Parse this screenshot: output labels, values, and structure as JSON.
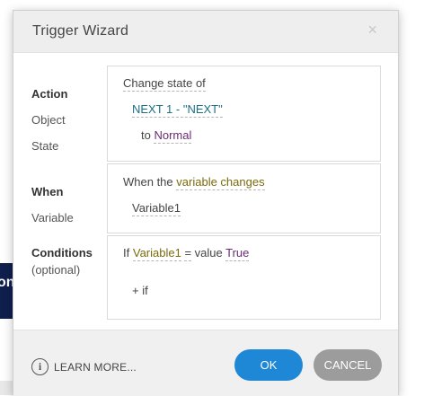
{
  "backdrop": {
    "fragment_text": "on"
  },
  "dialog": {
    "title": "Trigger Wizard",
    "close_symbol": "×"
  },
  "action_section": {
    "label": "Action",
    "object_label": "Object",
    "state_label": "State",
    "action_value": "Change state of",
    "object_value": "NEXT 1 - \"NEXT\"",
    "state_prefix": "to",
    "state_value": "Normal"
  },
  "when_section": {
    "label": "When",
    "variable_label": "Variable",
    "when_prefix": "When the",
    "when_value": "variable changes",
    "variable_value": "Variable1"
  },
  "conditions_section": {
    "label": "Conditions",
    "optional_label": "(optional)",
    "if_word": "If",
    "condition_variable": "Variable1",
    "operator": "=",
    "value_word": "value",
    "condition_value": "True",
    "add_condition": "+ if"
  },
  "footer": {
    "info_symbol": "i",
    "learn_more": "LEARN MORE...",
    "ok_label": "OK",
    "cancel_label": "CANCEL"
  },
  "colors": {
    "ok_button": "#1e88d6",
    "cancel_button": "#9c9c9c",
    "object_link": "#1b6f86",
    "state_link": "#6a2b72",
    "when_link": "#7a6b0c"
  }
}
